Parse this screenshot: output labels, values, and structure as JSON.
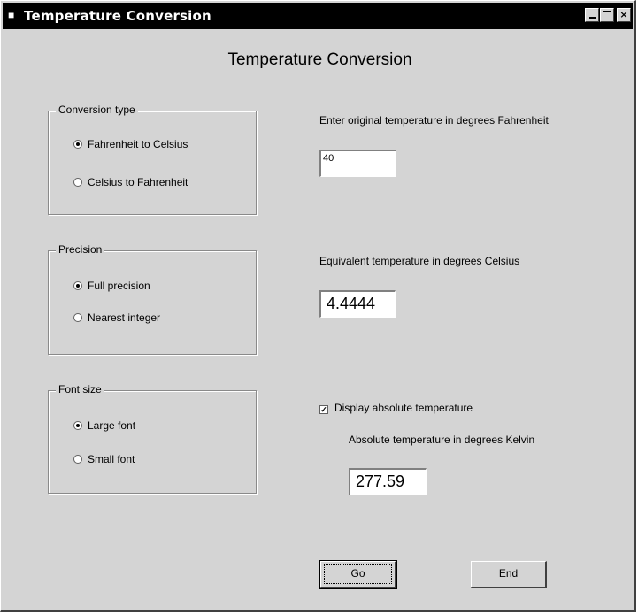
{
  "window": {
    "title": "Temperature Conversion",
    "buttons": {
      "minimize": "minimize-icon",
      "maximize": "maximize-icon",
      "close": "×"
    }
  },
  "heading": "Temperature Conversion",
  "conversion_type": {
    "legend": "Conversion type",
    "options": [
      {
        "label": "Fahrenheit to Celsius",
        "checked": true
      },
      {
        "label": "Celsius to Fahrenheit",
        "checked": false
      }
    ]
  },
  "precision": {
    "legend": "Precision",
    "options": [
      {
        "label": "Full precision",
        "checked": true
      },
      {
        "label": "Nearest integer",
        "checked": false
      }
    ]
  },
  "font_size": {
    "legend": "Font size",
    "options": [
      {
        "label": "Large font",
        "checked": true
      },
      {
        "label": "Small font",
        "checked": false
      }
    ]
  },
  "input": {
    "label": "Enter original temperature in degrees Fahrenheit",
    "value": "40"
  },
  "result": {
    "label": "Equivalent temperature in degrees Celsius",
    "value": "4.4444"
  },
  "absolute": {
    "checkbox_label": "Display absolute temperature",
    "checked": true,
    "label": "Absolute temperature in degrees Kelvin",
    "value": "277.59"
  },
  "actions": {
    "go": "Go",
    "end": "End"
  }
}
